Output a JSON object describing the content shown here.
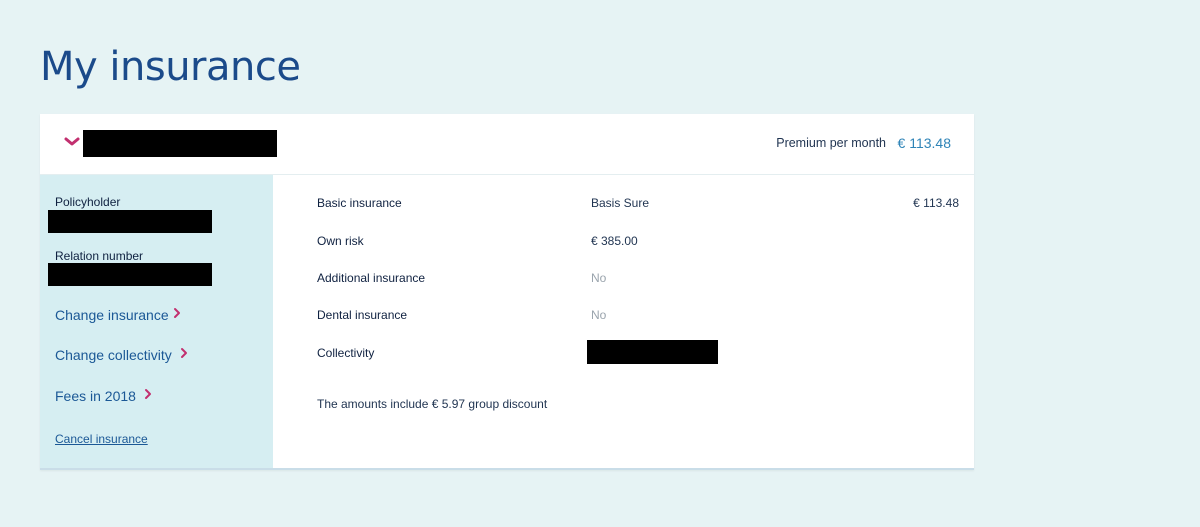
{
  "page": {
    "title": "My insurance"
  },
  "header": {
    "premium_label": "Premium per month",
    "premium_value": "€ 113.48"
  },
  "sidebar": {
    "policyholder_label": "Policyholder",
    "relation_label": "Relation number",
    "links": [
      {
        "label": "Change insurance"
      },
      {
        "label": "Change collectivity"
      },
      {
        "label": "Fees in 2018"
      }
    ],
    "cancel_label": "Cancel insurance"
  },
  "details": {
    "rows": [
      {
        "label": "Basic insurance",
        "value": "Basis Sure",
        "amount": "€ 113.48"
      },
      {
        "label": "Own risk",
        "value": "€ 385.00"
      },
      {
        "label": "Additional insurance",
        "value": "No"
      },
      {
        "label": "Dental insurance",
        "value": "No"
      },
      {
        "label": "Collectivity"
      }
    ],
    "discount_note": "The amounts include € 5.97 group discount"
  },
  "colors": {
    "background": "#e6f3f4",
    "title": "#1b4a8a",
    "accent_chevron": "#c2306f",
    "link": "#1b5896",
    "premium": "#2f84b7",
    "sidebar": "#d6eef2"
  },
  "icons": {
    "header_toggle": "chevron-down-icon",
    "link_arrow": "chevron-right-icon"
  }
}
